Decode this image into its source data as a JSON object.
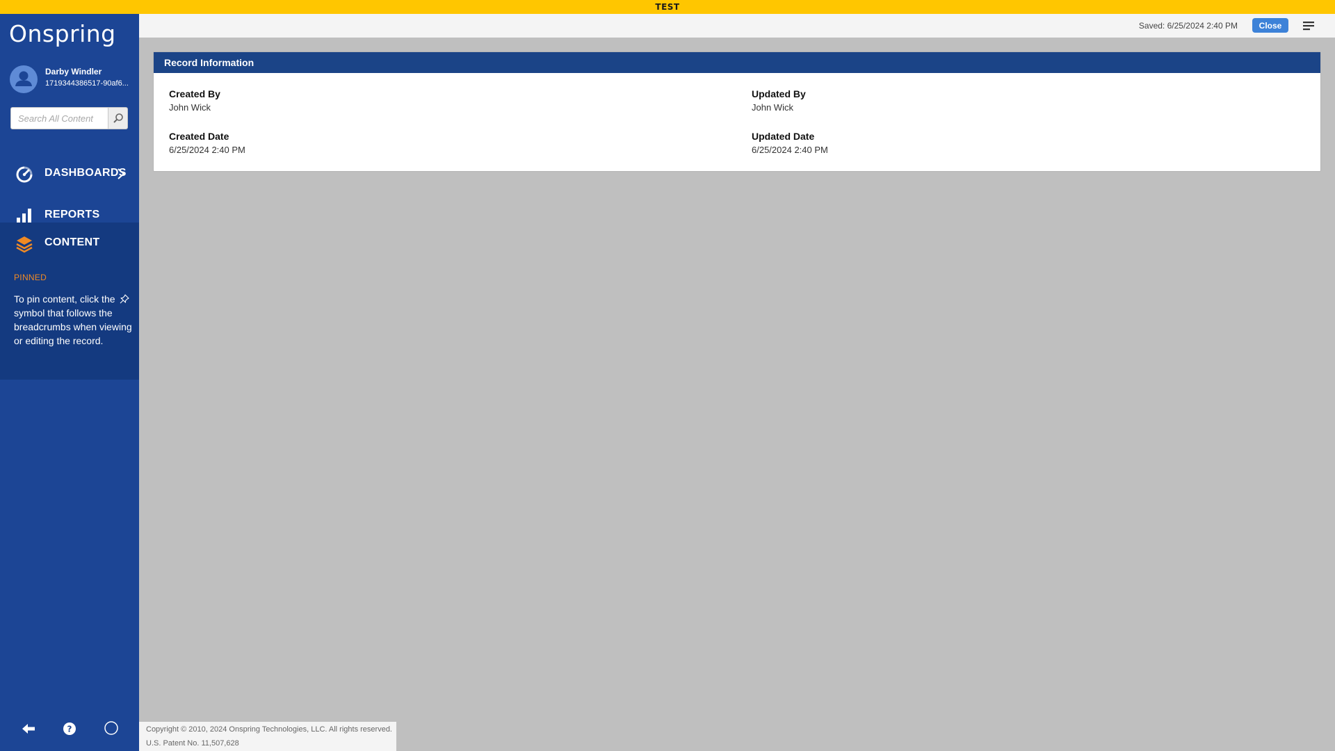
{
  "banner": {
    "text": "TEST",
    "color": "#ffc600"
  },
  "sidebar": {
    "logo": "Onspring",
    "background": "#1c4595",
    "user": {
      "name": "Darby Windler",
      "id": "1719344386517-90af6..."
    },
    "search": {
      "placeholder": "Search All Content",
      "value": ""
    },
    "nav": [
      {
        "label": "DASHBOARDS",
        "icon": "gauge-icon",
        "has_chevron": true
      },
      {
        "label": "REPORTS",
        "icon": "bar-chart-icon"
      },
      {
        "label": "CONTENT",
        "icon": "layers-icon",
        "active": true
      }
    ],
    "pinned": {
      "heading": "PINNED",
      "text_before": "To pin content, click the",
      "text_after": "symbol that follows the breadcrumbs when viewing or editing the record.",
      "icon": "pin-icon"
    },
    "footer_icons": [
      "back-arrow-icon",
      "help-icon",
      "profile-circle-icon"
    ]
  },
  "topbar": {
    "saved": "Saved: 6/25/2024 2:40 PM",
    "close_label": "Close",
    "menu_icon": "hamburger-menu-icon"
  },
  "record_info": {
    "title": "Record Information",
    "created_by": {
      "label": "Created By",
      "value": "John Wick"
    },
    "updated_by": {
      "label": "Updated By",
      "value": "John Wick"
    },
    "created_date": {
      "label": "Created Date",
      "value": "6/25/2024 2:40 PM"
    },
    "updated_date": {
      "label": "Updated Date",
      "value": "6/25/2024 2:40 PM"
    }
  },
  "footer": {
    "copyright": "Copyright © 2010, 2024 Onspring Technologies, LLC. All rights reserved.",
    "patent": "U.S. Patent No. 11,507,628"
  },
  "colors": {
    "accent_orange": "#f08a24",
    "header_blue": "#1b4487",
    "button_blue": "#3d82d8",
    "page_background": "#bfbfbf"
  }
}
